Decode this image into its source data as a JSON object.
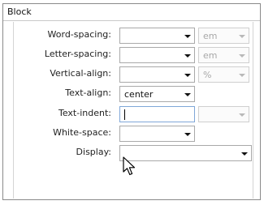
{
  "panel": {
    "title": "Block"
  },
  "rows": {
    "word_spacing": {
      "label": "Word-spacing:",
      "value": "",
      "unit": "em"
    },
    "letter_spacing": {
      "label": "Letter-spacing:",
      "value": "",
      "unit": "em"
    },
    "vertical_align": {
      "label": "Vertical-align:",
      "value": "",
      "unit": "%"
    },
    "text_align": {
      "label": "Text-align:",
      "value": "center"
    },
    "text_indent": {
      "label": "Text-indent:",
      "value": "",
      "unit": ""
    },
    "white_space": {
      "label": "White-space:",
      "value": ""
    },
    "display": {
      "label": "Display:",
      "value": ""
    }
  },
  "icons": {
    "dropdown": "chevron-down-icon",
    "cursor": "mouse-pointer-icon"
  }
}
